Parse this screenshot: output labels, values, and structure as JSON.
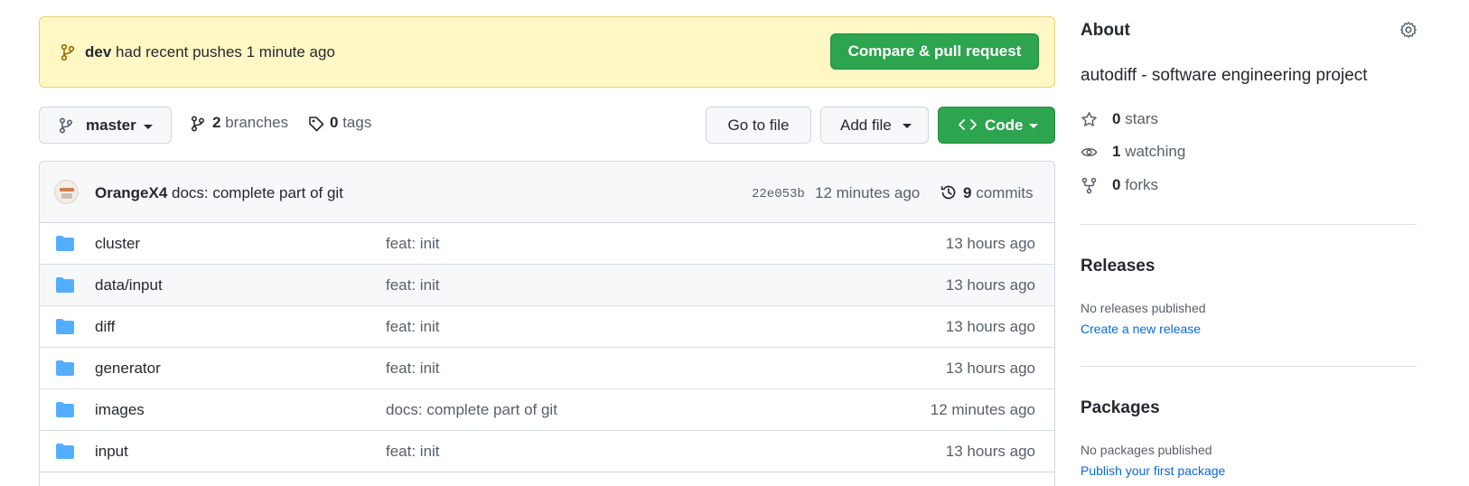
{
  "banner": {
    "branch": "dev",
    "message": "had recent pushes 1 minute ago",
    "button_label": "Compare & pull request"
  },
  "toolbar": {
    "current_branch": "master",
    "branches_count": "2",
    "branches_label": "branches",
    "tags_count": "0",
    "tags_label": "tags",
    "goto_file_label": "Go to file",
    "add_file_label": "Add file",
    "code_label": "Code"
  },
  "latest_commit": {
    "author": "OrangeX4",
    "message": "docs: complete part of git",
    "sha": "22e053b",
    "time": "12 minutes ago",
    "commits_count": "9",
    "commits_label": "commits"
  },
  "files": [
    {
      "name": "cluster",
      "message": "feat: init",
      "age": "13 hours ago"
    },
    {
      "name": "data/input",
      "message": "feat: init",
      "age": "13 hours ago"
    },
    {
      "name": "diff",
      "message": "feat: init",
      "age": "13 hours ago"
    },
    {
      "name": "generator",
      "message": "feat: init",
      "age": "13 hours ago"
    },
    {
      "name": "images",
      "message": "docs: complete part of git",
      "age": "12 minutes ago"
    },
    {
      "name": "input",
      "message": "feat: init",
      "age": "13 hours ago"
    }
  ],
  "about": {
    "title": "About",
    "description": "autodiff - software engineering project",
    "stars_count": "0",
    "stars_label": "stars",
    "watching_count": "1",
    "watching_label": "watching",
    "forks_count": "0",
    "forks_label": "forks"
  },
  "releases": {
    "title": "Releases",
    "empty_text": "No releases published",
    "create_link": "Create a new release"
  },
  "packages": {
    "title": "Packages",
    "empty_text": "No packages published",
    "publish_link": "Publish your first package"
  },
  "colors": {
    "primary_green": "#2da44e",
    "banner_bg": "#fff8c5",
    "folder_blue": "#54aeff",
    "link_blue": "#0969da"
  },
  "icons": {
    "branch": "git-branch-icon",
    "tag": "tag-icon",
    "code": "code-icon",
    "history": "history-icon",
    "folder": "folder-icon",
    "gear": "gear-icon",
    "star": "star-icon",
    "eye": "eye-icon",
    "fork": "repo-forked-icon"
  }
}
